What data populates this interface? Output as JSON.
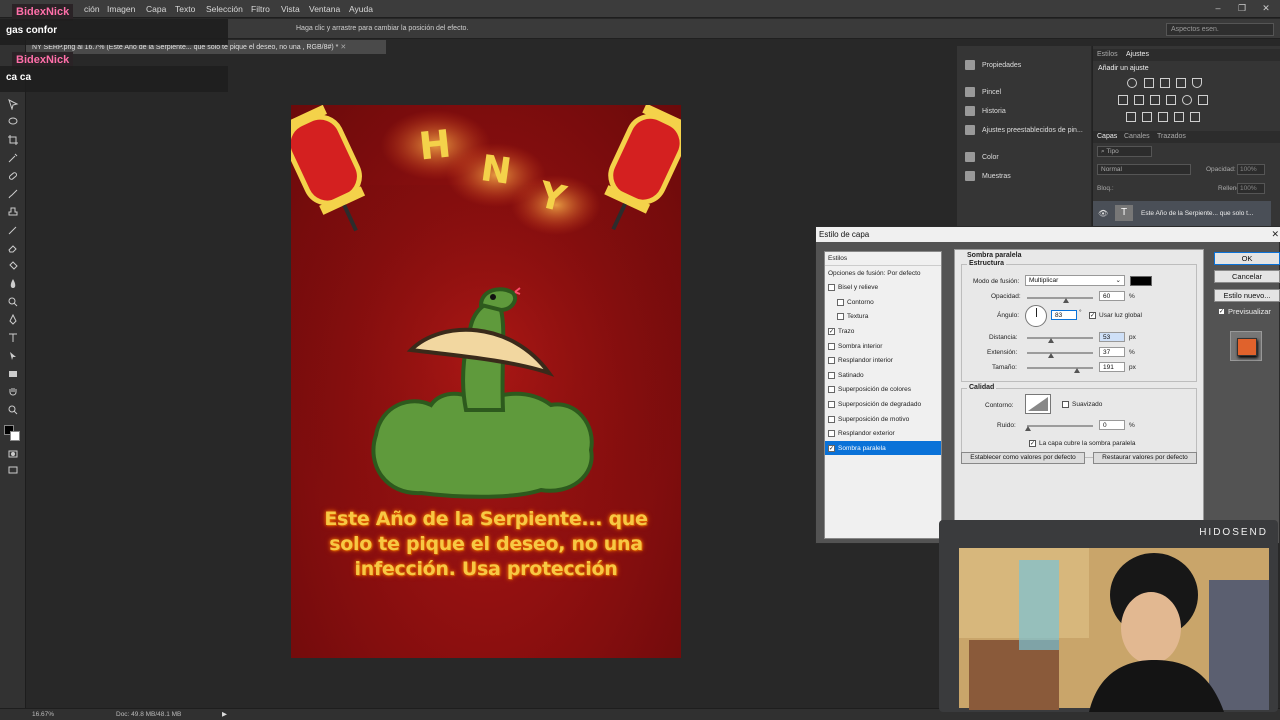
{
  "menubar": {
    "items": [
      "ción",
      "Imagen",
      "Capa",
      "Texto",
      "Selección",
      "Filtro",
      "Vista",
      "Ventana",
      "Ayuda"
    ]
  },
  "optionsbar": {
    "hint": "Haga clic y arrastre para cambiar la posición del efecto.",
    "workspace": "Aspectos esen."
  },
  "document_tab": "NY SERP.png al 16.7% (Este Año de la Serpiente... que solo te pique el deseo, no una , RGB/8#) *",
  "poster": {
    "letters": [
      "H",
      "N",
      "Y"
    ],
    "caption": "Este Año de la Serpiente... que solo te pique el deseo, no una infección. Usa protección"
  },
  "statusbar": {
    "zoom": "16.67%",
    "doc": "Doc: 49.8 MB/48.1 MB"
  },
  "dock": {
    "items": [
      "Propiedades",
      "Pincel",
      "Historia",
      "Ajustes preestablecidos de pin...",
      "Color",
      "Muestras"
    ]
  },
  "right_panel": {
    "tabs_top": [
      "Estilos",
      "Ajustes"
    ],
    "add_adjustment": "Añadir un ajuste",
    "tabs_layers": [
      "Capas",
      "Canales",
      "Trazados"
    ],
    "kind": "Tipo",
    "blend": "Normal",
    "opacity_label": "Opacidad:",
    "opacity_value": "100%",
    "lock_label": "Bloq.:",
    "fill_label": "Relleno:",
    "fill_value": "100%",
    "layer_name": "Este Año de la Serpiente... que solo t..."
  },
  "dialog": {
    "title": "Estilo de capa",
    "styles_header": "Estilos",
    "styles": [
      {
        "label": "Opciones de fusión: Por defecto",
        "check": null,
        "indent": false
      },
      {
        "label": "Bisel y relieve",
        "check": false,
        "indent": false
      },
      {
        "label": "Contorno",
        "check": false,
        "indent": true
      },
      {
        "label": "Textura",
        "check": false,
        "indent": true
      },
      {
        "label": "Trazo",
        "check": true,
        "indent": false
      },
      {
        "label": "Sombra interior",
        "check": false,
        "indent": false
      },
      {
        "label": "Resplandor interior",
        "check": false,
        "indent": false
      },
      {
        "label": "Satinado",
        "check": false,
        "indent": false
      },
      {
        "label": "Superposición de colores",
        "check": false,
        "indent": false
      },
      {
        "label": "Superposición de degradado",
        "check": false,
        "indent": false
      },
      {
        "label": "Superposición de motivo",
        "check": false,
        "indent": false
      },
      {
        "label": "Resplandor exterior",
        "check": false,
        "indent": false
      },
      {
        "label": "Sombra paralela",
        "check": true,
        "indent": false
      }
    ],
    "section_title": "Sombra paralela",
    "structure": "Estructura",
    "blend_mode_label": "Modo de fusión:",
    "blend_mode": "Multiplicar",
    "opacity_label": "Opacidad:",
    "opacity": "60",
    "angle_label": "Ángulo:",
    "angle": "83",
    "global_light": "Usar luz global",
    "distance_label": "Distancia:",
    "distance": "53",
    "spread_label": "Extensión:",
    "spread": "37",
    "size_label": "Tamaño:",
    "size": "191",
    "unit_px": "px",
    "unit_pct": "%",
    "degree": "°",
    "quality": "Calidad",
    "contour_label": "Contorno:",
    "antialias": "Suavizado",
    "noise_label": "Ruido:",
    "noise": "0",
    "knockout": "La capa cubre la sombra paralela",
    "make_default": "Establecer como valores por defecto",
    "reset_default": "Restaurar valores por defecto",
    "ok": "OK",
    "cancel": "Cancelar",
    "new_style": "Estilo nuevo...",
    "preview": "Previsualizar"
  },
  "chat": [
    {
      "name": "BidexNick",
      "message": "gas confor"
    },
    {
      "name": "BidexNick",
      "message": "ca ca"
    }
  ],
  "webcam": {
    "label": "HIDOSEND"
  },
  "colors": {
    "accent": "#0a72d8",
    "poster_red": "#8c0f0f",
    "caption_yellow": "#f7c843",
    "chat_name": "#ff6fa9"
  }
}
